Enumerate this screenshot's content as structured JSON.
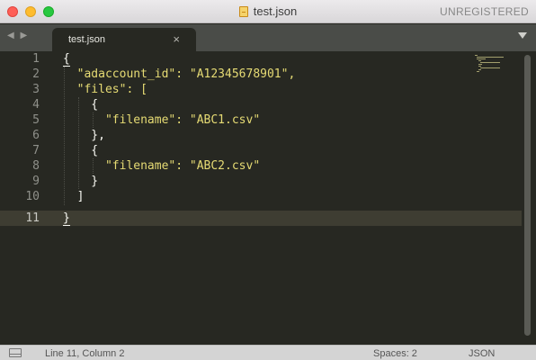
{
  "window": {
    "title": "test.json",
    "license_status": "UNREGISTERED"
  },
  "tabs": [
    {
      "label": "test.json",
      "close": "×",
      "active": true
    }
  ],
  "nav": {
    "arrows": "◀ ▶"
  },
  "editor": {
    "line_numbers": [
      "1",
      "2",
      "3",
      "4",
      "5",
      "6",
      "7",
      "8",
      "9",
      "10",
      "11"
    ],
    "active_line": 11,
    "lines": [
      "{",
      "  \"adaccount_id\": \"A12345678901\",",
      "  \"files\": [",
      "    {",
      "      \"filename\": \"ABC1.csv\"",
      "    },",
      "    {",
      "      \"filename\": \"ABC2.csv\"",
      "    }",
      "  ]",
      "}"
    ],
    "theme_colors": {
      "background": "#272822",
      "string": "#e6db74",
      "text": "#f8f8f2",
      "gutter": "#8f908a"
    }
  },
  "status": {
    "position": "Line 11, Column 2",
    "indentation": "Spaces: 2",
    "syntax": "JSON"
  }
}
